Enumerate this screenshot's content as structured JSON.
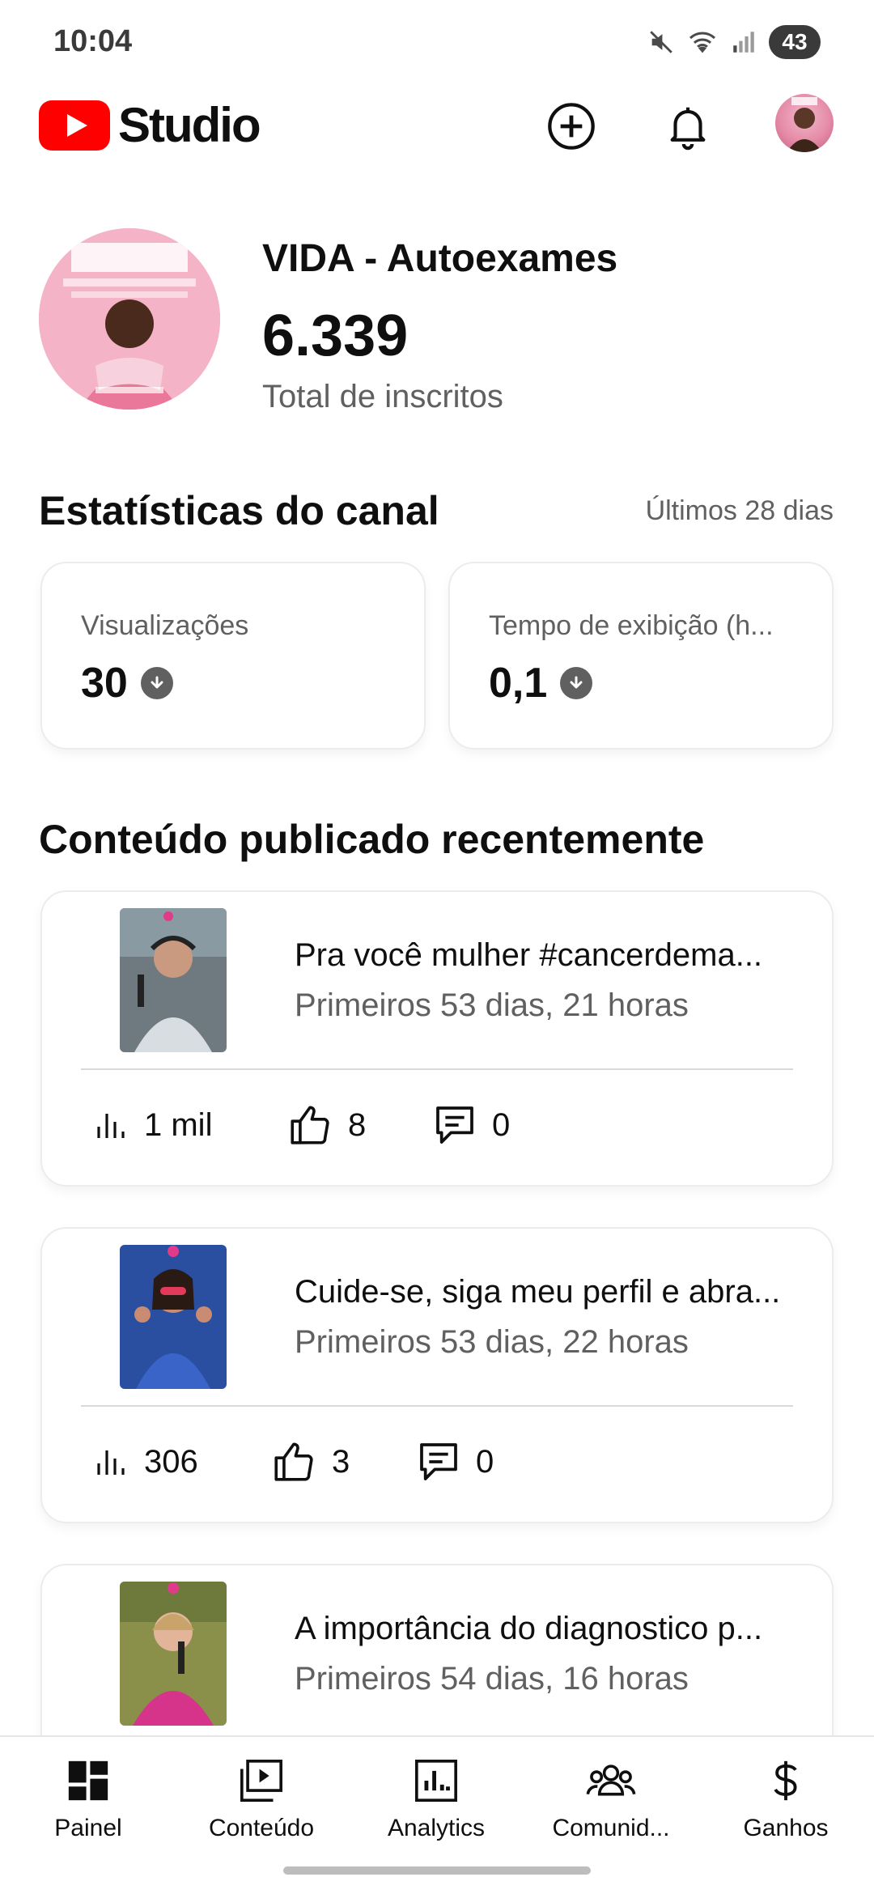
{
  "status_bar": {
    "time": "10:04",
    "battery": "43",
    "icons": [
      "mute-icon",
      "wifi-icon",
      "signal-icon",
      "battery-icon"
    ]
  },
  "app_bar": {
    "logo_text": "Studio",
    "icons": [
      "youtube-logo-icon",
      "create-icon",
      "bell-icon",
      "account-avatar"
    ],
    "brand_color": "#FF0000"
  },
  "channel": {
    "name": "VIDA - Autoexames",
    "subscribers": "6.339",
    "subscribers_label": "Total de inscritos"
  },
  "stats": {
    "title": "Estatísticas do canal",
    "period": "Últimos 28 dias",
    "cards": [
      {
        "label": "Visualizações",
        "value": "30",
        "trend": "down"
      },
      {
        "label": "Tempo de exibição (h...",
        "value": "0,1",
        "trend": "down"
      }
    ]
  },
  "recent": {
    "title": "Conteúdo publicado recentemente",
    "videos": [
      {
        "title": "Pra você mulher #cancerdema...",
        "subtitle": "Primeiros 53 dias, 21 horas",
        "views": "1 mil",
        "likes": "8",
        "comments": "0"
      },
      {
        "title": "Cuide-se, siga meu perfil e abra...",
        "subtitle": "Primeiros 53 dias, 22 horas",
        "views": "306",
        "likes": "3",
        "comments": "0"
      },
      {
        "title": "A importância do diagnostico p...",
        "subtitle": "Primeiros 54 dias, 16 horas"
      }
    ]
  },
  "bottom_nav": {
    "items": [
      {
        "label": "Painel",
        "icon": "dashboard-icon"
      },
      {
        "label": "Conteúdo",
        "icon": "content-icon"
      },
      {
        "label": "Analytics",
        "icon": "analytics-icon"
      },
      {
        "label": "Comunid...",
        "icon": "community-icon"
      },
      {
        "label": "Ganhos",
        "icon": "dollar-icon"
      }
    ]
  }
}
